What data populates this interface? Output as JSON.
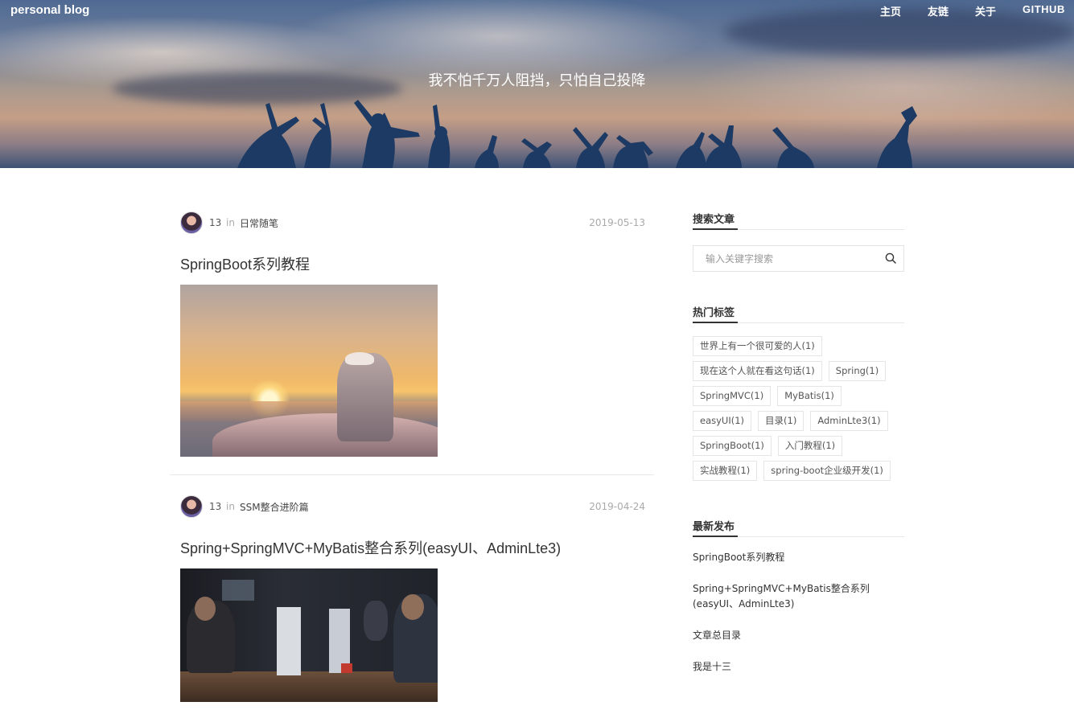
{
  "header": {
    "brand": "personal blog",
    "nav": [
      "主页",
      "友链",
      "关于",
      "GITHUB"
    ],
    "slogan": "我不怕千万人阻挡，只怕自己投降"
  },
  "posts": [
    {
      "author": "13",
      "in": "in",
      "category": "日常随笔",
      "date": "2019-05-13",
      "title": "SpringBoot系列教程"
    },
    {
      "author": "13",
      "in": "in",
      "category": "SSM整合进阶篇",
      "date": "2019-04-24",
      "title": "Spring+SpringMVC+MyBatis整合系列(easyUI、AdminLte3)"
    }
  ],
  "sidebar": {
    "search_heading": "搜索文章",
    "search_placeholder": "输入关键字搜索",
    "tags_heading": "热门标签",
    "tags": [
      "世界上有一个很可爱的人(1)",
      "现在这个人就在看这句话(1)",
      "Spring(1)",
      "SpringMVC(1)",
      "MyBatis(1)",
      "easyUI(1)",
      "目录(1)",
      "AdminLte3(1)",
      "SpringBoot(1)",
      "入门教程(1)",
      "实战教程(1)",
      "spring-boot企业级开发(1)"
    ],
    "recent_heading": "最新发布",
    "recent": [
      "SpringBoot系列教程",
      "Spring+SpringMVC+MyBatis整合系列(easyUI、AdminLte3)",
      "文章总目录",
      "我是十三"
    ]
  },
  "icons": {
    "search": "search-icon",
    "avatar": "avatar"
  }
}
